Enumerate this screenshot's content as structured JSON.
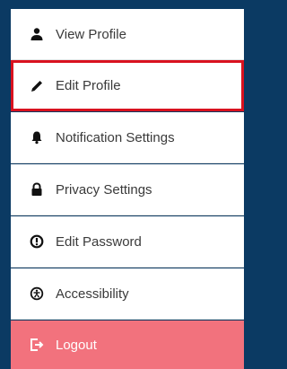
{
  "menu": {
    "items": [
      {
        "label": "View Profile",
        "icon": "user-icon"
      },
      {
        "label": "Edit Profile",
        "icon": "pencil-icon",
        "selected": true
      },
      {
        "label": "Notification Settings",
        "icon": "bell-icon"
      },
      {
        "label": "Privacy Settings",
        "icon": "lock-icon"
      },
      {
        "label": "Edit Password",
        "icon": "password-icon"
      },
      {
        "label": "Accessibility",
        "icon": "accessibility-icon"
      },
      {
        "label": "Logout",
        "icon": "logout-icon"
      }
    ]
  },
  "colors": {
    "background": "#0b3a63",
    "item_bg": "#ffffff",
    "selected_border": "#d9121f",
    "logout_bg": "#f2727d"
  }
}
